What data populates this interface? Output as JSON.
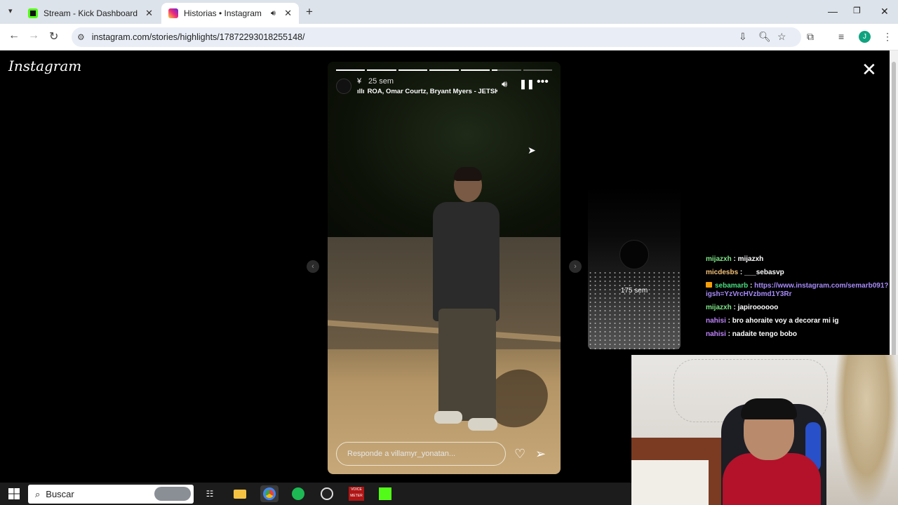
{
  "browser": {
    "tabs": [
      {
        "title": "Stream - Kick Dashboard",
        "favicon_color": "#53fc18"
      },
      {
        "title": "Historias • Instagram",
        "favicon_color": "#e1306c",
        "audio": true
      }
    ],
    "url": "instagram.com/stories/highlights/17872293018255148/",
    "profile_initial": "J"
  },
  "instagram": {
    "logo": "Instagram",
    "story": {
      "user": "¥",
      "time": "25 sem",
      "song": "ROA, Omar Courtz, Bryant Myers - JETSKI (Re",
      "reply_placeholder": "Responde a villamyr_yonatan...",
      "segments": 7,
      "current_segment": 6,
      "current_progress": 0.2
    },
    "next_story": {
      "time": "175 sem"
    }
  },
  "chat": [
    {
      "user": "mijazxh",
      "color": "#7ee787",
      "message": "mijazxh"
    },
    {
      "user": "micdesbs",
      "color": "#f6c177",
      "message": "___sebasvp"
    },
    {
      "user": "sebamarb",
      "color": "#4ade80",
      "message": "https://www.instagram.com/semarb091?igsh=YzVrcHVzbmd1Y3Rr",
      "badge": true,
      "is_link": true
    },
    {
      "user": "mijazxh",
      "color": "#7ee787",
      "message": "japiroooooo"
    },
    {
      "user": "nahisi",
      "color": "#c084fc",
      "message": "bro ahoraite voy a decorar mi ig"
    },
    {
      "user": "nahisi",
      "color": "#c084fc",
      "message": "nadaite tengo bobo"
    }
  ],
  "taskbar": {
    "search_label": "Buscar",
    "voicemeeter_label": "VOICE METER"
  }
}
